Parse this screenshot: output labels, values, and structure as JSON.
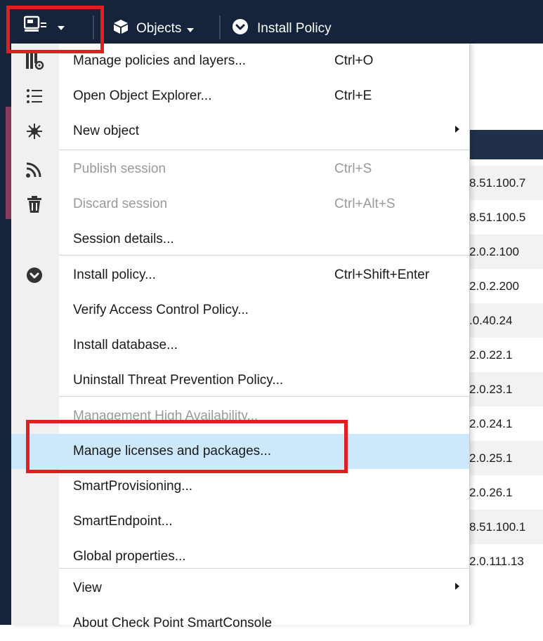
{
  "toolbar": {
    "objects_label": "Objects",
    "install_policy_label": "Install Policy"
  },
  "ip_list": [
    "8.51.100.7",
    "8.51.100.5",
    "2.0.2.100",
    "2.0.2.200",
    ".0.40.24",
    "2.0.22.1",
    "2.0.23.1",
    "2.0.24.1",
    "2.0.25.1",
    "2.0.26.1",
    "8.51.100.1",
    "2.0.111.13"
  ],
  "menu": {
    "items": [
      {
        "label": "Manage policies and layers...",
        "shortcut": "Ctrl+O",
        "icon": "policies-layers-icon"
      },
      {
        "label": "Open Object Explorer...",
        "shortcut": "Ctrl+E",
        "icon": "list-icon"
      },
      {
        "label": "New object",
        "shortcut": "",
        "icon": "star-icon",
        "submenu": true
      },
      {
        "label": "Publish session",
        "shortcut": "Ctrl+S",
        "icon": "publish-icon",
        "disabled": true
      },
      {
        "label": "Discard session",
        "shortcut": "Ctrl+Alt+S",
        "icon": "trash-icon",
        "disabled": true
      },
      {
        "label": "Session details...",
        "shortcut": ""
      },
      {
        "label": "Install policy...",
        "shortcut": "Ctrl+Shift+Enter",
        "icon": "install-icon"
      },
      {
        "label": "Verify Access Control Policy...",
        "shortcut": ""
      },
      {
        "label": "Install database...",
        "shortcut": ""
      },
      {
        "label": "Uninstall Threat Prevention Policy...",
        "shortcut": ""
      },
      {
        "label": "Management High Availability...",
        "shortcut": "",
        "disabled": true
      },
      {
        "label": "Manage licenses and packages...",
        "shortcut": "",
        "selected": true
      },
      {
        "label": "SmartProvisioning...",
        "shortcut": ""
      },
      {
        "label": "SmartEndpoint...",
        "shortcut": ""
      },
      {
        "label": "Global properties...",
        "shortcut": ""
      },
      {
        "label": "View",
        "shortcut": "",
        "submenu": true
      },
      {
        "label": "About Check Point SmartConsole",
        "shortcut": ""
      }
    ]
  },
  "colors": {
    "toolbar_bg": "#15243a",
    "highlight": "#e02020",
    "selected_row": "#cde8fb"
  }
}
